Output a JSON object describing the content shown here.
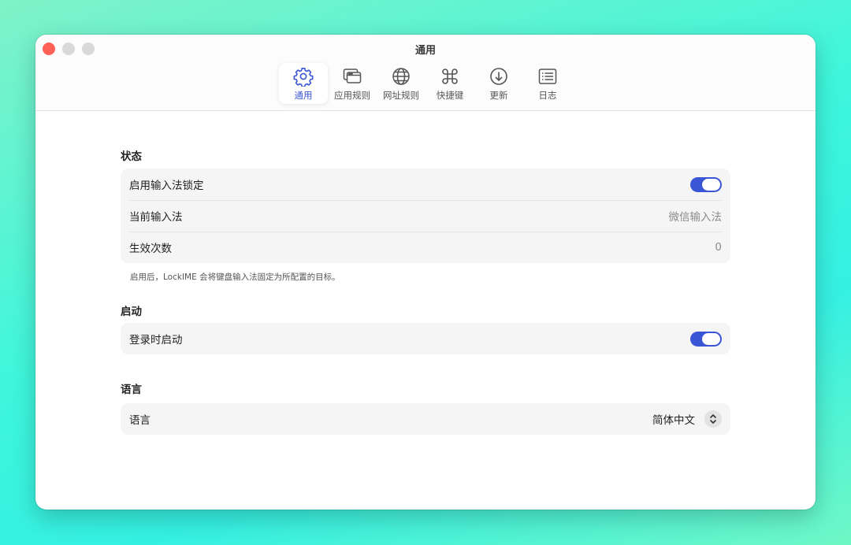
{
  "window": {
    "title": "通用"
  },
  "toolbar": {
    "tabs": [
      {
        "label": "通用",
        "icon": "gear-icon",
        "active": true
      },
      {
        "label": "应用规则",
        "icon": "app-windows-icon",
        "active": false
      },
      {
        "label": "网址规则",
        "icon": "globe-icon",
        "active": false
      },
      {
        "label": "快捷键",
        "icon": "command-key-icon",
        "active": false
      },
      {
        "label": "更新",
        "icon": "download-circle-icon",
        "active": false
      },
      {
        "label": "日志",
        "icon": "log-list-icon",
        "active": false
      }
    ]
  },
  "sections": {
    "status": {
      "title": "状态",
      "enable_lock_label": "启用输入法锁定",
      "enable_lock_on": true,
      "current_ime_label": "当前输入法",
      "current_ime_value": "微信输入法",
      "count_label": "生效次数",
      "count_value": "0",
      "note": "启用后，LockIME 会将键盘输入法固定为所配置的目标。"
    },
    "startup": {
      "title": "启动",
      "launch_at_login_label": "登录时启动",
      "launch_at_login_on": true
    },
    "language": {
      "title": "语言",
      "language_label": "语言",
      "language_value": "简体中文"
    }
  },
  "colors": {
    "accent": "#3a55d6",
    "close": "#fe5f57",
    "group_bg": "#f5f5f5"
  }
}
